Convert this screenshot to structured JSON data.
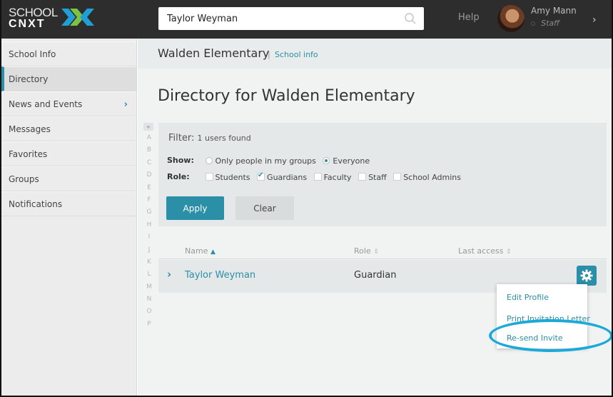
{
  "brand": {
    "line1": "SCHOOL",
    "line2": "CNXT"
  },
  "search": {
    "value": "Taylor Weyman",
    "placeholder": ""
  },
  "header": {
    "help": "Help",
    "user_name": "Amy Mann",
    "user_role": "Staff"
  },
  "sidebar": {
    "items": [
      {
        "label": "School Info"
      },
      {
        "label": "Directory"
      },
      {
        "label": "News and Events"
      },
      {
        "label": "Messages"
      },
      {
        "label": "Favorites"
      },
      {
        "label": "Groups"
      },
      {
        "label": "Notifications"
      }
    ]
  },
  "breadcrumb": {
    "title": "Walden Elementary",
    "separator": "|",
    "link": "School info"
  },
  "page": {
    "title": "Directory for Walden Elementary"
  },
  "alphabet": {
    "toggle": "«",
    "letters": [
      "A",
      "B",
      "C",
      "D",
      "E",
      "F",
      "G",
      "H",
      "I",
      "J",
      "K",
      "L",
      "M",
      "N",
      "O",
      "P"
    ]
  },
  "filter": {
    "title": "Filter:",
    "count": "1 users found",
    "show_label": "Show:",
    "show_options": [
      "Only people in my groups",
      "Everyone"
    ],
    "role_label": "Role:",
    "roles": [
      "Students",
      "Guardians",
      "Faculty",
      "Staff",
      "School Admins"
    ],
    "apply": "Apply",
    "clear": "Clear"
  },
  "table": {
    "columns": [
      "Name",
      "Role",
      "Last access"
    ],
    "rows": [
      {
        "name": "Taylor Weyman",
        "role": "Guardian",
        "last_access": ""
      }
    ]
  },
  "row_menu": {
    "items": [
      "Edit Profile",
      "Print Invitation Letter",
      "Re-send Invite"
    ]
  },
  "colors": {
    "accent": "#2b8fa8",
    "topbar": "#2d2d2d",
    "highlight": "#1aa9d9"
  }
}
